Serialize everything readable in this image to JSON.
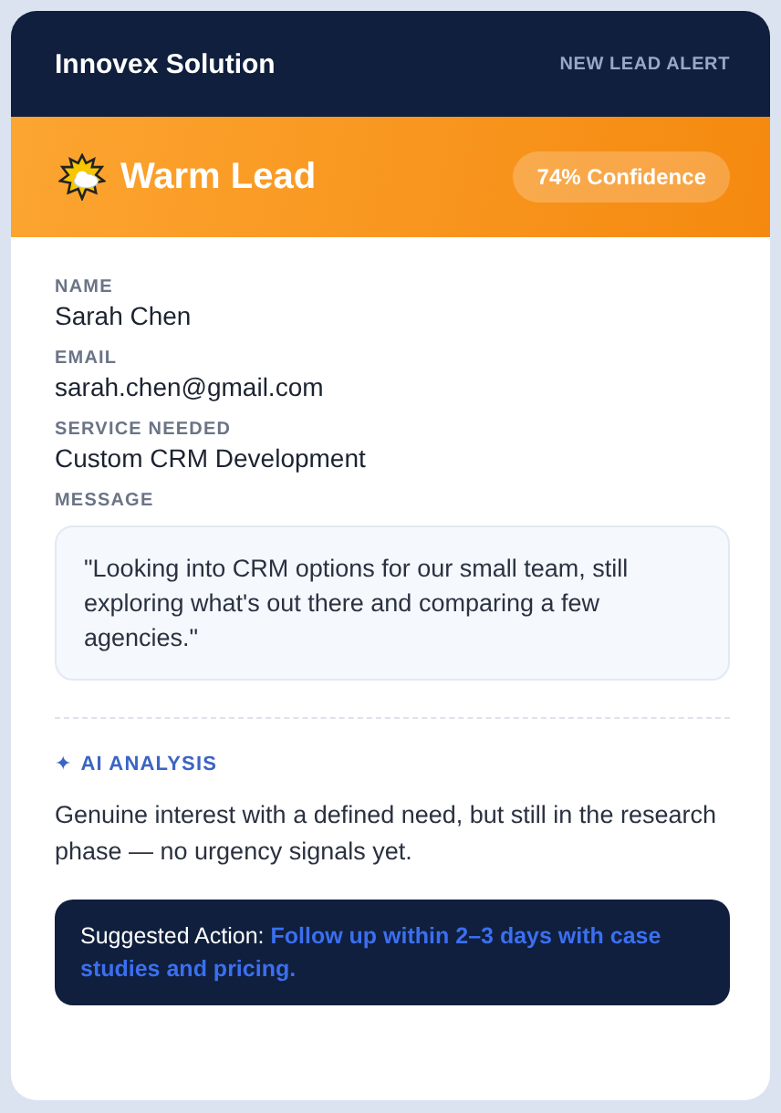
{
  "header": {
    "brand": "Innovex Solution",
    "alert": "NEW LEAD ALERT"
  },
  "lead": {
    "kind": "warm",
    "title": "Warm Lead",
    "confidence": "74% Confidence"
  },
  "fields": [
    {
      "label": "NAME",
      "value": "Sarah Chen"
    },
    {
      "label": "EMAIL",
      "value": "sarah.chen@gmail.com"
    },
    {
      "label": "SERVICE NEEDED",
      "value": "Custom CRM Development"
    }
  ],
  "message": {
    "label": "MESSAGE",
    "text": "\"Looking into CRM options for our small team, still exploring what's out there and comparing a few agencies.\""
  },
  "analysis": {
    "icon": "✦",
    "label": "AI ANALYSIS",
    "text": "Genuine interest with a defined need, but still in the research phase — no urgency signals yet."
  },
  "suggestion": {
    "text": "Suggested Action: **Follow up within 2–3 days with case studies and pricing.**"
  }
}
